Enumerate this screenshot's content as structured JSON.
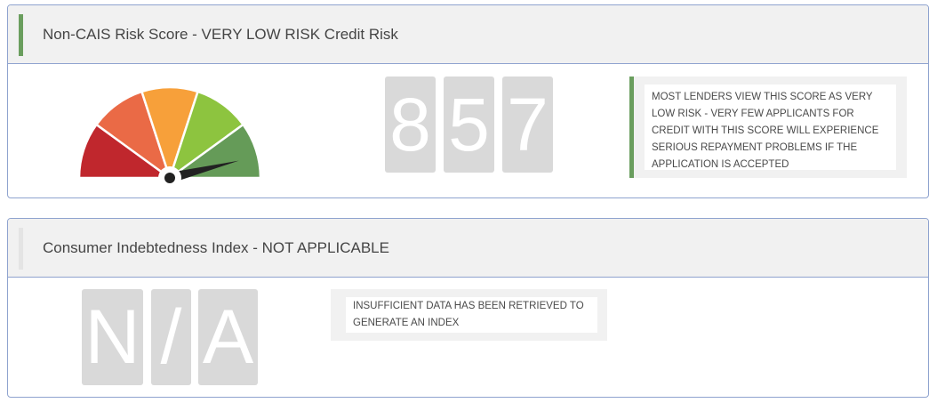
{
  "risk_score": {
    "title": "Non-CAIS Risk Score - VERY LOW RISK Credit Risk",
    "accent_color": "#6a9e5e",
    "gauge": {
      "segment_colors": [
        "#c0272d",
        "#ea6a46",
        "#f7a03a",
        "#8dc43f",
        "#659b58"
      ],
      "needle_color": "#222222"
    },
    "score_digits": [
      "8",
      "5",
      "7"
    ],
    "description": "MOST LENDERS VIEW THIS SCORE AS VERY LOW RISK - VERY FEW APPLICANTS FOR CREDIT WITH THIS SCORE WILL EXPERIENCE SERIOUS REPAYMENT PROBLEMS IF THE APPLICATION IS ACCEPTED"
  },
  "indebtedness": {
    "title": "Consumer Indebtedness Index - NOT APPLICABLE",
    "accent_color": "#e4e4e4",
    "value_digits": [
      "N",
      "/",
      "A"
    ],
    "description": "INSUFFICIENT DATA HAS BEEN RETRIEVED TO GENERATE AN INDEX"
  }
}
